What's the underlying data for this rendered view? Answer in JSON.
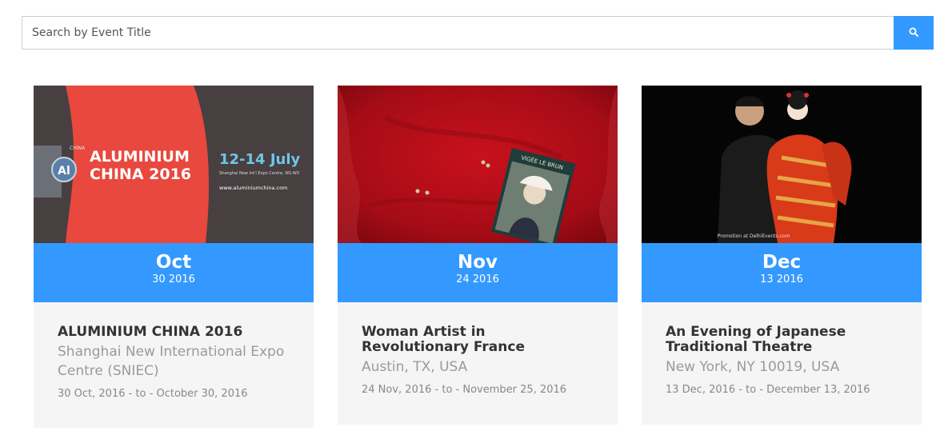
{
  "search": {
    "placeholder": "Search by Event Title",
    "button_icon": "search-icon"
  },
  "colors": {
    "accent": "#3399ff",
    "card_bg": "#f5f5f5",
    "title": "#333333",
    "venue": "#9a9a9a",
    "dates": "#888888"
  },
  "events": [
    {
      "month": "Oct",
      "day_year": "30 2016",
      "title": "ALUMINIUM CHINA 2016",
      "venue": "Shanghai New International Expo Centre (SNIEC)",
      "dates": "30 Oct, 2016 - to - October 30, 2016",
      "image": {
        "logo_text": "CHINA",
        "headline_line1": "ALUMINIUM",
        "headline_line2": "CHINA 2016",
        "date_text": "12-14 July",
        "venue_text": "Shanghai New Int'l Expo Centre, W1-W3",
        "url_text": "www.aluminiumchina.com"
      }
    },
    {
      "month": "Nov",
      "day_year": "24 2016",
      "title": "Woman Artist in Revolutionary France",
      "venue": "Austin, TX, USA",
      "dates": "24 Nov, 2016 - to - November 25, 2016",
      "image": {
        "book_text": "VIGÉE LE BRUN"
      }
    },
    {
      "month": "Dec",
      "day_year": "13 2016",
      "title": "An Evening of Japanese Traditional Theatre",
      "venue": "New York, NY 10019, USA",
      "dates": "13 Dec, 2016 - to - December 13, 2016",
      "image": {
        "credit_text": "Promotion at DelhiEvents.com"
      }
    }
  ]
}
